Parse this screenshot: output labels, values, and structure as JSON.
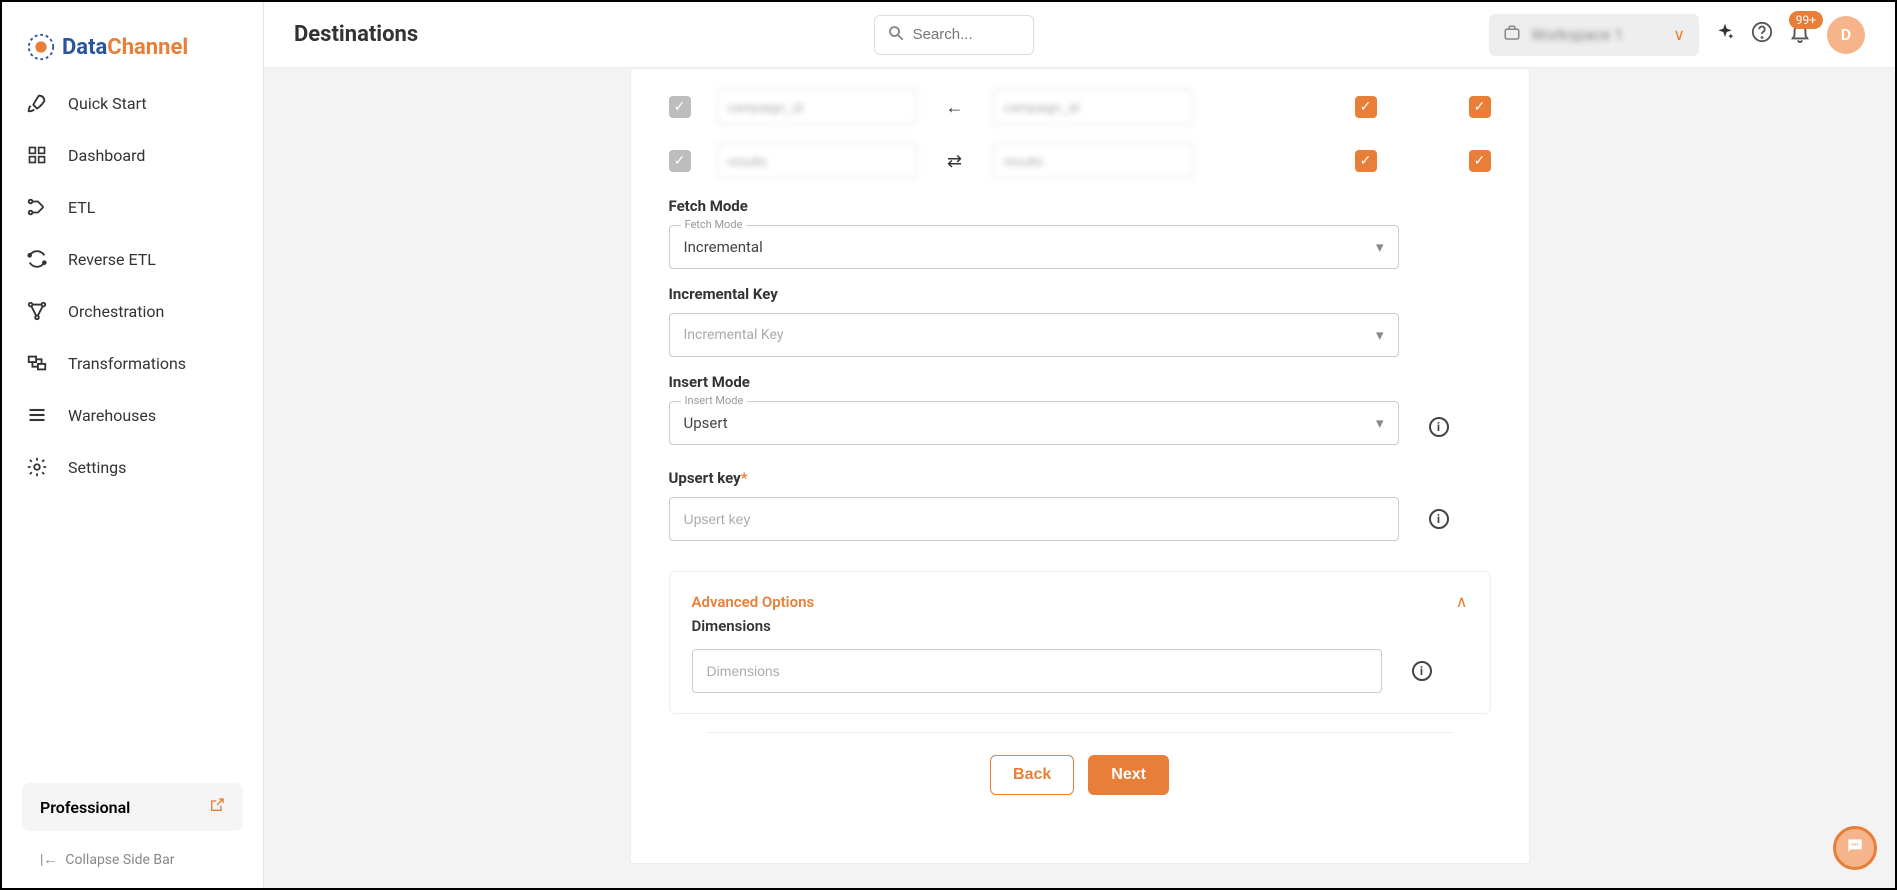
{
  "brand": {
    "prefix": "Data",
    "suffix": "Channel"
  },
  "sidebar": {
    "items": [
      {
        "label": "Quick Start"
      },
      {
        "label": "Dashboard"
      },
      {
        "label": "ETL"
      },
      {
        "label": "Reverse ETL"
      },
      {
        "label": "Orchestration"
      },
      {
        "label": "Transformations"
      },
      {
        "label": "Warehouses"
      },
      {
        "label": "Settings"
      }
    ],
    "plan": "Professional",
    "collapse": "Collapse Side Bar"
  },
  "header": {
    "title": "Destinations",
    "search_placeholder": "Search...",
    "notif_count": "99+",
    "avatar_letter": "D",
    "workspace": "Workspace 1"
  },
  "form": {
    "mappings": [
      {
        "left": "campaign_id",
        "right": "campaign_id",
        "connector": "←"
      },
      {
        "left": "results",
        "right": "results",
        "connector": "⇄"
      }
    ],
    "fetch_mode": {
      "label": "Fetch Mode",
      "value": "Incremental",
      "float": "Fetch Mode"
    },
    "incremental_key": {
      "label": "Incremental Key",
      "placeholder": "Incremental Key"
    },
    "insert_mode": {
      "label": "Insert Mode",
      "value": "Upsert",
      "float": "Insert Mode"
    },
    "upsert_key": {
      "label": "Upsert key",
      "placeholder": "Upsert key"
    },
    "advanced": {
      "title": "Advanced Options",
      "dimensions_label": "Dimensions",
      "dimensions_placeholder": "Dimensions"
    },
    "buttons": {
      "back": "Back",
      "next": "Next"
    }
  }
}
